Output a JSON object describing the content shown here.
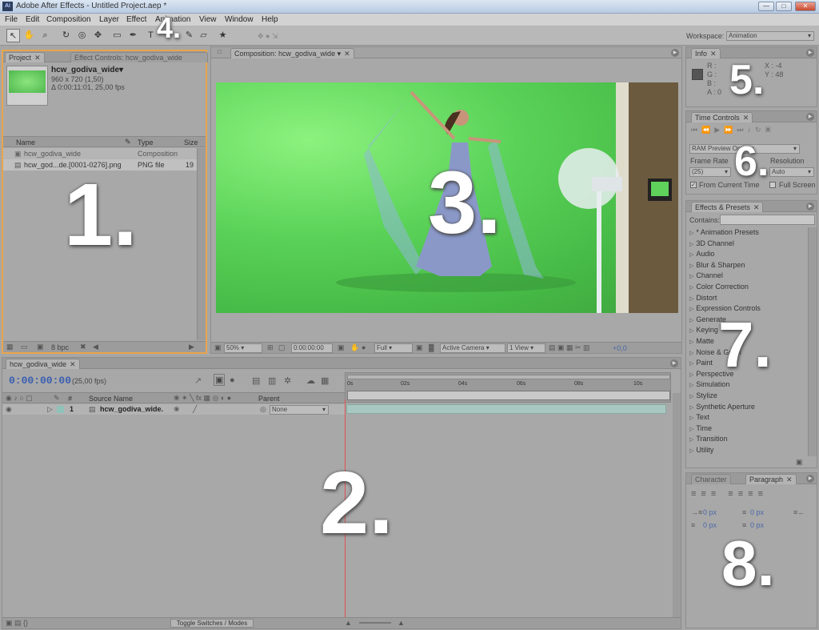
{
  "window": {
    "title": "Adobe After Effects - Untitled Project.aep *",
    "app_icon": "Ai",
    "min_button": "—",
    "max_button": "□",
    "close_button": "✕"
  },
  "menu": {
    "items": [
      "File",
      "Edit",
      "Composition",
      "Layer",
      "Effect",
      "Animation",
      "View",
      "Window",
      "Help"
    ]
  },
  "toolbar": {
    "tools": [
      "selection-icon",
      "hand-icon",
      "zoom-icon",
      "rotate-icon",
      "orbit-camera-icon",
      "track-xy-icon",
      "rectangle-mask-icon",
      "pen-icon",
      "text-icon",
      "brush-icon",
      "eraser-icon",
      "puppet-pin-icon"
    ],
    "workspace_label": "Workspace:",
    "workspace_value": "Animation"
  },
  "project": {
    "tab": "Project",
    "tab2": "Effect Controls: hcw_godiva_wide",
    "name": "hcw_godiva_wide▾",
    "size": "960 x 720 (1,50)",
    "duration": "Δ 0:00:11:01, 25,00 fps",
    "columns": [
      "Name",
      "Type",
      "Size"
    ],
    "rows": [
      {
        "name": "hcw_godiva_wide",
        "type": "Composition",
        "size": ""
      },
      {
        "name": "hcw_god...de.[0001-0276].png",
        "type": "PNG file",
        "size": "19"
      }
    ],
    "bpc": "8 bpc"
  },
  "composition": {
    "tab": "Composition: hcw_godiva_wide",
    "zoom": "50%",
    "timecode": "0:00:00:00",
    "resolution": "Full",
    "camera": "Active Camera",
    "view": "1 View",
    "exposure": "+0,0"
  },
  "timeline": {
    "tab": "hcw_godiva_wide",
    "timecode": "0:00:00:00",
    "fps": "(25,00 fps)",
    "ruler": [
      "0s",
      "02s",
      "04s",
      "06s",
      "08s",
      "10s"
    ],
    "col_num": "#",
    "col_source": "Source Name",
    "col_parent": "Parent",
    "layer_num": "1",
    "layer_name": "hcw_godiva_wide.",
    "parent_value": "None",
    "toggle_label": "Toggle Switches / Modes"
  },
  "info": {
    "tab": "Info",
    "r": "R :",
    "g": "G :",
    "b": "B :",
    "a": "A : 0",
    "x": "X : -4",
    "y": "Y : 48"
  },
  "time_controls": {
    "tab": "Time Controls",
    "preview": "RAM Preview Options",
    "frame_rate_label": "Frame Rate",
    "frame_rate": "(25)",
    "resolution_label": "Resolution",
    "resolution": "Auto",
    "from_current": "From Current Time",
    "full_screen": "Full Screen"
  },
  "effects": {
    "tab": "Effects & Presets",
    "contains": "Contains:",
    "items": [
      "* Animation Presets",
      "3D Channel",
      "Audio",
      "Blur & Sharpen",
      "Channel",
      "Color Correction",
      "Distort",
      "Expression Controls",
      "Generate",
      "Keying",
      "Matte",
      "Noise & Grain",
      "Paint",
      "Perspective",
      "Simulation",
      "Stylize",
      "Synthetic Aperture",
      "Text",
      "Time",
      "Transition",
      "Utility"
    ]
  },
  "paragraph": {
    "tab1": "Character",
    "tab2": "Paragraph",
    "val1": "0 px",
    "val2": "0 px",
    "val3": "0 px",
    "val4": "0 px",
    "val5": "0 px"
  },
  "labels": [
    "1.",
    "2.",
    "3.",
    "4.",
    "5.",
    "6.",
    "7.",
    "8."
  ]
}
